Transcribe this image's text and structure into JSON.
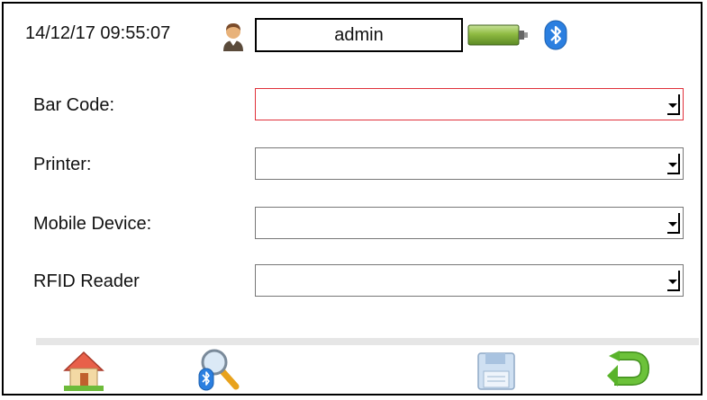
{
  "status": {
    "datetime": "14/12/17 09:55:07",
    "user": "admin",
    "user_icon": "user-icon",
    "battery_icon": "battery-icon",
    "bluetooth_icon": "bluetooth-icon"
  },
  "form": {
    "fields": [
      {
        "label": "Bar Code:",
        "value": "",
        "focused": true
      },
      {
        "label": "Printer:",
        "value": "",
        "focused": false
      },
      {
        "label": "Mobile Device:",
        "value": "",
        "focused": false
      },
      {
        "label": "RFID Reader",
        "value": "",
        "focused": false
      }
    ]
  },
  "toolbar": {
    "buttons": [
      "home-icon",
      "bluetooth-search-icon",
      "save-icon",
      "back-arrow-icon"
    ]
  },
  "colors": {
    "focus_border": "#e0303a",
    "battery_green": "#7ea83a",
    "bluetooth_blue": "#2b7fe0",
    "back_arrow_green": "#59b32a"
  }
}
